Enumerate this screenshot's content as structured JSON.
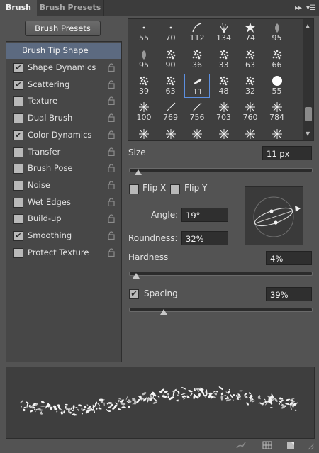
{
  "tabs": {
    "brush": "Brush",
    "brush_presets": "Brush Presets"
  },
  "left_panel": {
    "presets_button": "Brush Presets",
    "tip_shape": "Brush Tip Shape",
    "options": [
      {
        "label": "Shape Dynamics",
        "checked": true
      },
      {
        "label": "Scattering",
        "checked": true
      },
      {
        "label": "Texture",
        "checked": false
      },
      {
        "label": "Dual Brush",
        "checked": false
      },
      {
        "label": "Color Dynamics",
        "checked": true
      },
      {
        "label": "Transfer",
        "checked": false
      },
      {
        "label": "Brush Pose",
        "checked": false
      },
      {
        "label": "Noise",
        "checked": false
      },
      {
        "label": "Wet Edges",
        "checked": false
      },
      {
        "label": "Build-up",
        "checked": false
      },
      {
        "label": "Smoothing",
        "checked": true
      },
      {
        "label": "Protect Texture",
        "checked": false
      }
    ]
  },
  "brush_grid": {
    "rows": [
      [
        "55",
        "70",
        "112",
        "134",
        "74",
        "95"
      ],
      [
        "95",
        "90",
        "36",
        "33",
        "63",
        "66"
      ],
      [
        "39",
        "63",
        "11",
        "48",
        "32",
        "55"
      ],
      [
        "100",
        "769",
        "756",
        "703",
        "760",
        "784"
      ]
    ],
    "selected": "11"
  },
  "controls": {
    "size_label": "Size",
    "size_value": "11 px",
    "size_level": 0.05,
    "flip_x": "Flip X",
    "flip_y": "Flip Y",
    "angle_label": "Angle:",
    "angle_value": "19°",
    "roundness_label": "Roundness:",
    "roundness_value": "32%",
    "hardness_label": "Hardness",
    "hardness_value": "4%",
    "hardness_level": 0.04,
    "spacing_label": "Spacing",
    "spacing_value": "39%",
    "spacing_checked": true,
    "spacing_level": 0.19
  },
  "colors": {
    "panel": "#535353",
    "selection": "#5c6a80",
    "field": "#2f2f2f",
    "highlight": "#5c8fe0"
  }
}
